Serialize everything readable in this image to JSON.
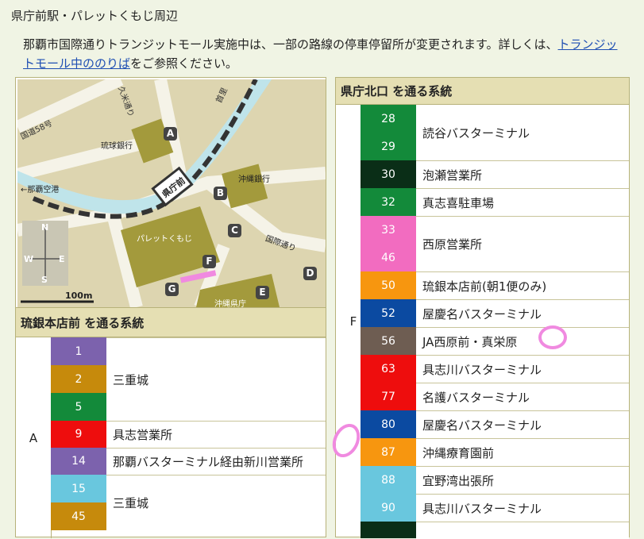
{
  "page": {
    "title": "県庁前駅・パレットくもじ周辺",
    "notice_prefix": "那覇市国際通りトランジットモール実施中は、一部の路線の停車停留所が変更されます。詳しくは、",
    "notice_link": "トランジットモール中ののりば",
    "notice_suffix": "をご参照ください。"
  },
  "map": {
    "labels": {
      "r58": "国道58号",
      "kumoji": "久米通り",
      "ryugin": "琉球銀行",
      "okigin": "沖縄銀行",
      "kenchomae": "県庁前",
      "naha_airport": "←那覇空港",
      "palette": "パレットくもじ",
      "kokusai": "国際通り",
      "kencho": "沖縄県庁",
      "shuri": "首里",
      "scale": "100m",
      "n": "N",
      "s": "S",
      "e": "E",
      "w": "W"
    },
    "stops": [
      "A",
      "B",
      "C",
      "D",
      "E",
      "F",
      "G"
    ]
  },
  "left_section": {
    "heading": "琉銀本店前 を通る系統",
    "stop_label": "A",
    "routes": [
      {
        "num": "1",
        "color": "#7c62ad"
      },
      {
        "num": "2",
        "color": "#c68a0c"
      },
      {
        "num": "5",
        "color": "#138a3a"
      },
      {
        "num": "9",
        "color": "#ee0d0d"
      },
      {
        "num": "14",
        "color": "#7c62ad"
      },
      {
        "num": "15",
        "color": "#69c7de"
      },
      {
        "num": "45",
        "color": "#c68a0c"
      }
    ],
    "destinations": [
      "三重城",
      "具志営業所",
      "那覇バスターミナル経由新川営業所",
      "三重城"
    ]
  },
  "right_section": {
    "heading": "県庁北口 を通る系統",
    "stop_label": "F",
    "routes": [
      {
        "num": "28",
        "color": "#138a3a"
      },
      {
        "num": "29",
        "color": "#138a3a"
      },
      {
        "num": "30",
        "color": "#0a2e17"
      },
      {
        "num": "32",
        "color": "#138a3a"
      },
      {
        "num": "33",
        "color": "#f26cc0"
      },
      {
        "num": "46",
        "color": "#f26cc0"
      },
      {
        "num": "50",
        "color": "#f7960f"
      },
      {
        "num": "52",
        "color": "#0b4aa1"
      },
      {
        "num": "56",
        "color": "#6e5d52"
      },
      {
        "num": "63",
        "color": "#ee0d0d"
      },
      {
        "num": "77",
        "color": "#ee0d0d"
      },
      {
        "num": "80",
        "color": "#0b4aa1"
      },
      {
        "num": "87",
        "color": "#f7960f"
      },
      {
        "num": "88",
        "color": "#69c7de"
      },
      {
        "num": "90",
        "color": "#69c7de"
      }
    ],
    "destinations": [
      "読谷バスターミナル",
      "泡瀬営業所",
      "真志喜駐車場",
      "西原営業所",
      "琉銀本店前(朝1便のみ)",
      "屋慶名バスターミナル",
      "JA西原前・真栄原",
      "具志川バスターミナル",
      "名護バスターミナル",
      "屋慶名バスターミナル",
      "沖縄療育園前",
      "宜野湾出張所",
      "具志川バスターミナル"
    ]
  }
}
